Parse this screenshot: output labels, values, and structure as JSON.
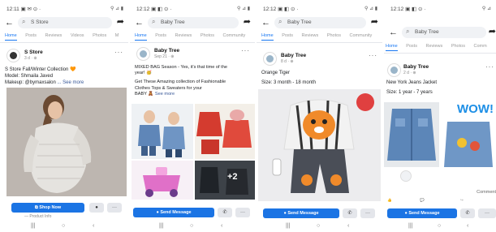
{
  "colors": {
    "accent": "#1877f2",
    "cta": "#1b74e4",
    "text": "#1c1e21",
    "muted": "#888888"
  },
  "nav_icons": [
    "recents-icon",
    "home-circle-icon",
    "back-chevron-icon"
  ],
  "screens": [
    {
      "status_time": "12:11 ▣ ✉ ⊙ ·",
      "status_right": "⚲ ⊿ ▮",
      "search": "S Store",
      "tabs": [
        "Home",
        "Posts",
        "Reviews",
        "Videos",
        "Photos",
        "M"
      ],
      "page_name": "S Store",
      "post_meta": "3 d · ⊕",
      "caption_lines": [
        "S Store Fall/Winter Collection 🧡",
        "Model: Shmaila Javed",
        "Makeup: @bymaxsalon"
      ],
      "see_more": "... See more",
      "cta": "Shop Now",
      "shared_by": "— Product Info"
    },
    {
      "status_time": "12:12 ▣ ◧ ⊙ ·",
      "status_right": "⚲ ⊿ ▮",
      "search": "Baby Tree",
      "tabs": [
        "Home",
        "Posts",
        "Reviews",
        "Photos",
        "Community"
      ],
      "page_name": "Baby Tree",
      "post_meta": "Sep 21 · ⊕",
      "caption_lines": [
        "MIXED BAG Season - Yes, it's that time of the",
        "year! 🥳",
        "",
        "Get These Amazing collection of Fashionable",
        "Clothes Tops & Sweaters for your",
        "BABY 🧸"
      ],
      "see_more": "See more",
      "overlay": "+2",
      "cta": "Send Message"
    },
    {
      "status_time": "12:12 ▣ ◧ ⊙ ·",
      "status_right": "⚲ ⊿ ▮",
      "search": "Baby Tree",
      "tabs": [
        "Home",
        "Posts",
        "Reviews",
        "Photos",
        "Community"
      ],
      "page_name": "Baby Tree",
      "post_meta": "8 d · ⊕",
      "caption_lines": [
        "Orange Tiger",
        "",
        "Size: 3 month - 18 month"
      ],
      "cta": "Send Message"
    },
    {
      "status_time": "12:12 ▣ ◧ ⊙ ·",
      "status_right": "⚲ ⊿",
      "search": "Baby Tree",
      "tabs": [
        "Home",
        "Posts",
        "Reviews",
        "Photos",
        "Comm"
      ],
      "page_name": "Baby Tree",
      "post_meta": "2 d · ⊕",
      "caption_lines": [
        "New York Jeans Jacket",
        "",
        "Size: 1 year - 7 years"
      ],
      "wow": "WOW!",
      "comment_label": "Comment",
      "cta": "Send Message"
    }
  ]
}
